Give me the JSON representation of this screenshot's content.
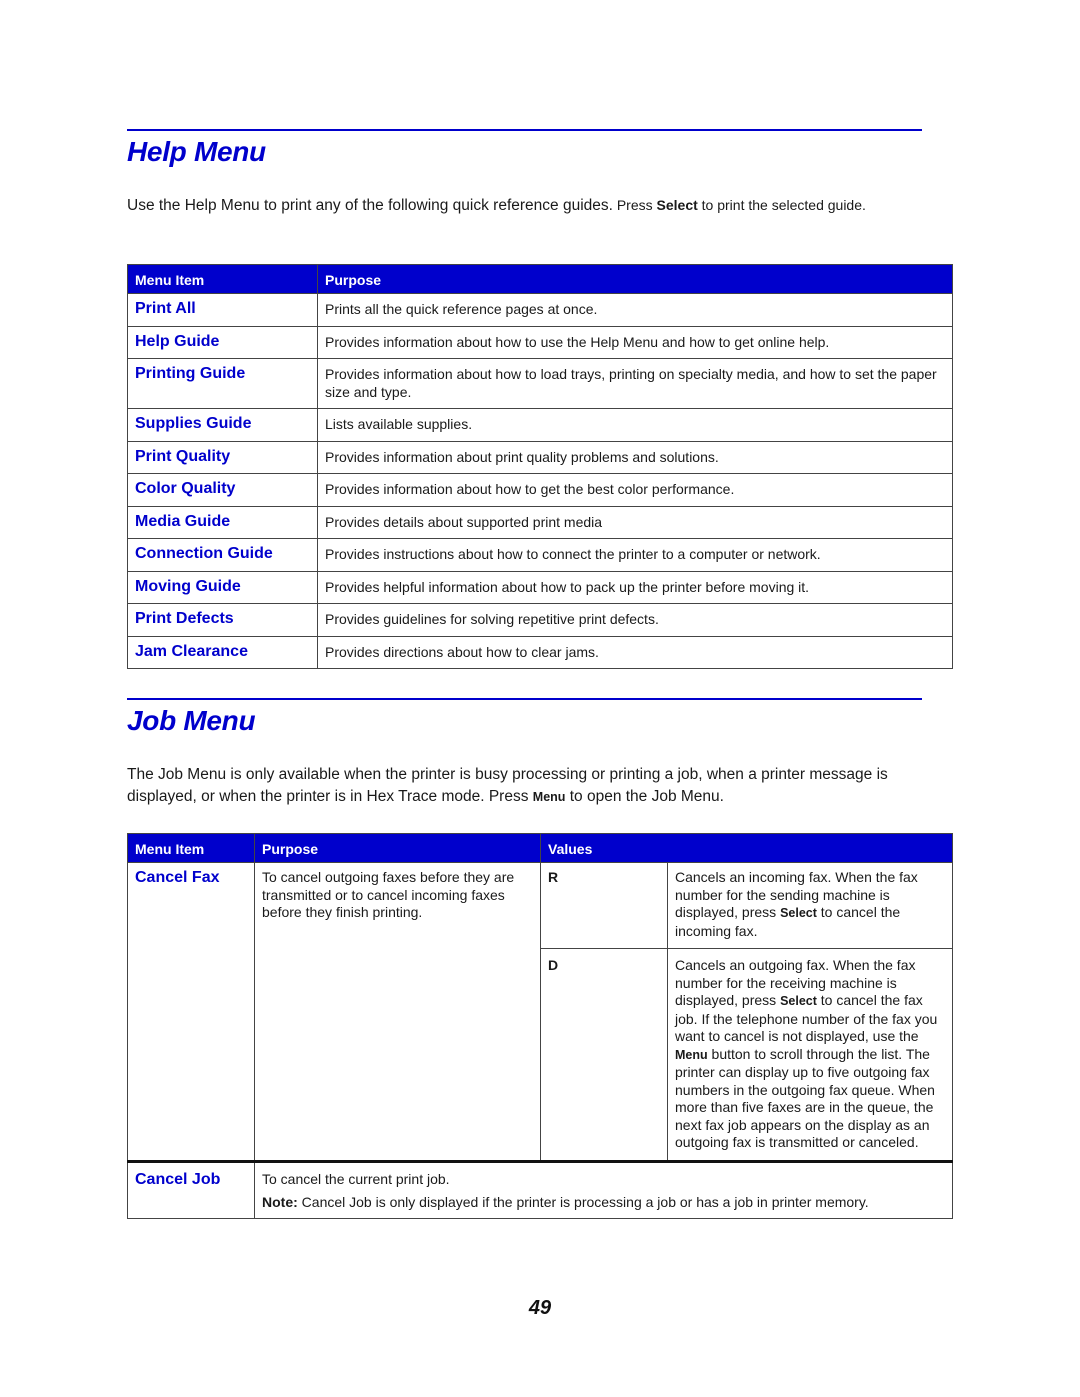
{
  "help_menu": {
    "title": "Help Menu",
    "intro": {
      "part1": "Use the Help Menu to print any of the following quick reference guides.",
      "part2_prefix": " Press ",
      "part2_key": "Select",
      "part2_suffix": " to print the selected guide."
    },
    "table": {
      "headers": [
        "Menu Item",
        "Purpose"
      ],
      "rows": [
        {
          "item": "Print All",
          "purpose": "Prints all the quick reference pages at once."
        },
        {
          "item": "Help Guide",
          "purpose": "Provides information about how to use the Help Menu and how to get online help."
        },
        {
          "item": "Printing Guide",
          "purpose": "Provides information about how to load trays, printing on specialty media, and how to set the paper size and type."
        },
        {
          "item": "Supplies Guide",
          "purpose": "Lists available supplies."
        },
        {
          "item": "Print Quality",
          "purpose": "Provides information about print quality problems and solutions."
        },
        {
          "item": "Color Quality",
          "purpose": "Provides information about how to get the best color performance."
        },
        {
          "item": "Media Guide",
          "purpose": "Provides details about supported print media"
        },
        {
          "item": "Connection Guide",
          "purpose": "Provides instructions about how to connect the printer to a computer or network."
        },
        {
          "item": "Moving Guide",
          "purpose": "Provides helpful information about how to pack up the printer before moving it."
        },
        {
          "item": "Print Defects",
          "purpose": "Provides guidelines for solving repetitive print defects."
        },
        {
          "item": "Jam Clearance",
          "purpose": "Provides directions about how to clear jams."
        }
      ]
    }
  },
  "job_menu": {
    "title": "Job Menu",
    "intro": {
      "part1": "The Job Menu is only available when the printer is busy processing or printing a job, when a printer message is displayed, or when the printer is in Hex Trace mode. Press ",
      "key": "Menu",
      "part2": " to open the Job Menu."
    },
    "table": {
      "headers": [
        "Menu Item",
        "Purpose",
        "Values"
      ],
      "cancel_fax": {
        "item": "Cancel Fax",
        "purpose": "To cancel outgoing faxes before they are transmitted or to cancel incoming faxes before they finish printing.",
        "values": [
          {
            "key": "R",
            "desc_prefix": "Cancels an incoming fax. When the fax number for the sending machine is displayed, press ",
            "desc_key": "Select",
            "desc_suffix": " to cancel the incoming fax."
          },
          {
            "key": "D",
            "desc_prefix": "Cancels an outgoing fax. When the fax number for the receiving machine is displayed, press ",
            "desc_key": "Select",
            "desc_middle": " to cancel the fax job. If the telephone number of the fax you want to cancel is not displayed, use the ",
            "desc_key2": "Menu",
            "desc_suffix": " button to scroll through the list. The printer can display up to five outgoing fax numbers in the outgoing fax queue. When more than five faxes are in the queue, the next fax job appears on the display as an outgoing fax is transmitted or canceled."
          }
        ]
      },
      "cancel_job": {
        "item": "Cancel Job",
        "purpose": "To cancel the current print job.",
        "note_label": "Note:",
        "note_text": " Cancel Job is only displayed if the printer is processing a job or has a job in printer memory."
      }
    }
  },
  "page_number": "49",
  "colors": {
    "accent": "#0000cc",
    "header_text": "#ffffff",
    "body_text": "#1a1a1a"
  }
}
